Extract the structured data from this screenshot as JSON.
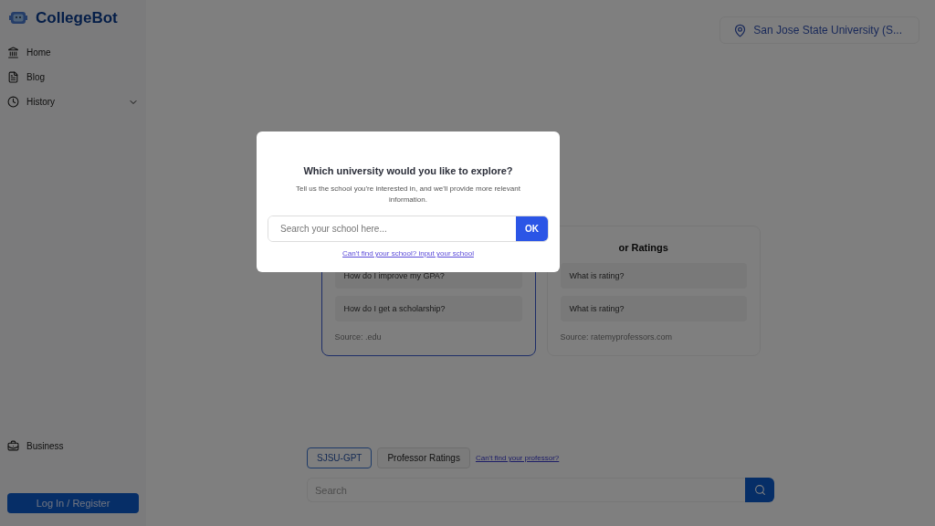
{
  "brand": {
    "name": "CollegeBot"
  },
  "sidebar": {
    "items": [
      {
        "label": "Home",
        "expandable": false
      },
      {
        "label": "Blog",
        "expandable": false
      },
      {
        "label": "History",
        "expandable": true
      }
    ],
    "bottom_items": [
      {
        "label": "Business"
      }
    ],
    "login_button": "Log In / Register"
  },
  "location": {
    "label": "San Jose State University (S..."
  },
  "cards": [
    {
      "selected": true,
      "questions": [
        "How do I improve my GPA?",
        "How do I get a scholarship?"
      ],
      "source": "Source: .edu"
    },
    {
      "title": "or Ratings",
      "selected": false,
      "questions": [
        "What is rating?",
        "What is rating?"
      ],
      "source": "Source: ratemyprofessors.com"
    }
  ],
  "mode_tabs": [
    {
      "label": "SJSU-GPT",
      "selected": true
    },
    {
      "label": "Professor Ratings",
      "selected": false
    }
  ],
  "professor_link": "Can't find your professor?",
  "search": {
    "placeholder": "Search"
  },
  "modal": {
    "title": "Which university would you like to explore?",
    "text": "Tell us the school you're interested in, and we'll provide more relevant information.",
    "placeholder": "Search your school here...",
    "ok": "OK",
    "link": "Can't find your school? input your school"
  }
}
